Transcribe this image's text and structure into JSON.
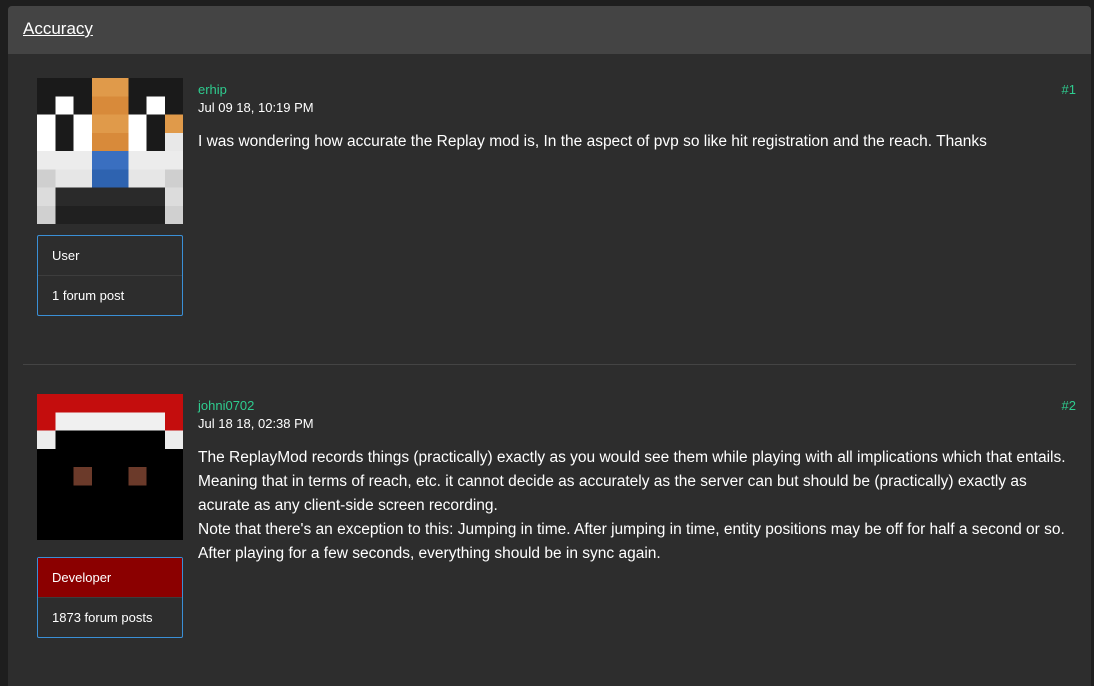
{
  "thread": {
    "title": "Accuracy"
  },
  "posts": [
    {
      "author": "erhip",
      "date": "Jul 09 18, 10:19 PM",
      "number": "#1",
      "role": "User",
      "post_count": "1 forum post",
      "paragraphs": [
        "I was wondering how accurate the Replay mod is, In the aspect of pvp so like hit registration and the reach. Thanks"
      ]
    },
    {
      "author": "johni0702",
      "date": "Jul 18 18, 02:38 PM",
      "number": "#2",
      "role": "Developer",
      "post_count": "1873 forum posts",
      "paragraphs": [
        "The ReplayMod records things (practically) exactly as you would see them while playing with all implications which that entails.",
        "Meaning that in terms of reach, etc. it cannot decide as accurately as the server can but should be (practically) exactly as acurate as any client-side screen recording.",
        "Note that there's an exception to this: Jumping in time. After jumping in time, entity positions may be off for half a second or so. After playing for a few seconds, everything should be in sync again."
      ]
    }
  ],
  "colors": {
    "accent": "#2ecc8f",
    "rank_border": "#3a8fd6",
    "developer_badge": "#8b0000",
    "panel_bg": "#2d2d2d",
    "header_bg": "#444444"
  }
}
